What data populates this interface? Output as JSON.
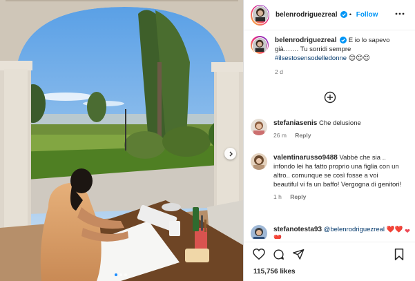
{
  "header": {
    "username": "belenrodriguezreal",
    "follow_label": "Follow"
  },
  "caption": {
    "username": "belenrodriguezreal",
    "text": "E io lo sapevo già……. Tu sorridi sempre",
    "hashtag": "#ilsestosensodelledonne",
    "emojis": "😊😊😊",
    "age": "2 d"
  },
  "comments": [
    {
      "username": "stefaniasenis",
      "text": "Che delusione",
      "age": "26 m",
      "reply_label": "Reply"
    },
    {
      "username": "valentinarusso9488",
      "text": "Vabbè che sia .. infondo lei ha fatto proprio una figlia con un altro.. comunque se così fosse a voi beautiful vi fa un baffo! Vergogna di genitori!",
      "age": "1 h",
      "reply_label": "Reply"
    },
    {
      "username": "stefanotesta93",
      "mention": "@belenrodriguezreal",
      "text": "❤️❤️❤️",
      "reaction": "❤"
    }
  ],
  "likes": "115,756 likes",
  "icons": {
    "more": "more-options-icon",
    "verified": "verified-badge-icon",
    "load_more": "plus-circle-icon",
    "like": "heart-icon",
    "comment": "comment-icon",
    "share": "share-icon",
    "save": "bookmark-icon",
    "next": "chevron-right-icon"
  },
  "colors": {
    "accent": "#0095f6",
    "verified": "#0095f6",
    "heart": "#ed4956",
    "hashtag": "#00376b"
  }
}
